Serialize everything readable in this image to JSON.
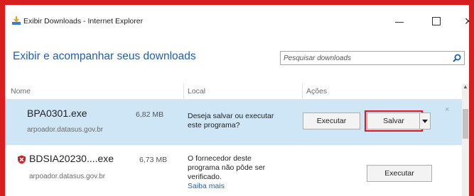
{
  "window": {
    "title": "Exibir Downloads - Internet Explorer",
    "minimize_glyph": "",
    "close_glyph": "×"
  },
  "header": {
    "heading": "Exibir e acompanhar seus downloads",
    "search_placeholder": "Pesquisar downloads"
  },
  "columns": {
    "name": "Nome",
    "local": "Local",
    "actions": "Ações"
  },
  "downloads": [
    {
      "name": "BPA0301.exe",
      "size": "6,82 MB",
      "host": "arpoador.datasus.gov.br",
      "status_line1": "Deseja salvar ou executar",
      "status_line2": "este programa?",
      "run_label": "Executar",
      "save_label": "Salvar",
      "dismiss_glyph": "×"
    },
    {
      "name": "BDSIA20230....exe",
      "size": "6,73 MB",
      "host": "arpoador.datasus.gov.br",
      "status_line1": "O fornecedor deste",
      "status_line2": "programa não pôde ser",
      "status_line3": "verificado.",
      "learn_more": "Saiba mais",
      "run_label": "Executar"
    }
  ],
  "colors": {
    "accent": "#1e5fb4",
    "selected_row": "#cfe6f7",
    "highlight": "#e0161e",
    "frame": "#d81e1e"
  },
  "icons": {
    "app": "ie-download-icon",
    "search": "search-icon",
    "warning": "shield-warning-icon"
  }
}
